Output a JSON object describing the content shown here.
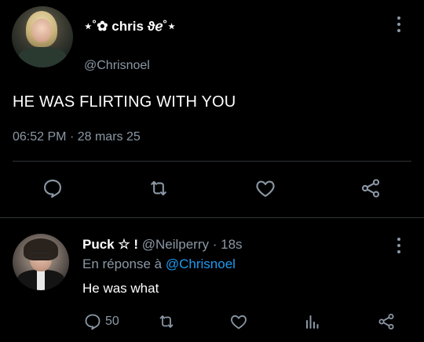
{
  "main_tweet": {
    "display_name": "⋆˚✿ chris ϑℯ˚⋆",
    "handle": "@Chrisnoel",
    "text": "HE WAS FLIRTING WITH YOU",
    "time": "06:52 PM",
    "separator": "·",
    "date": "28 mars 25",
    "icons": [
      "reply-icon",
      "retweet-icon",
      "like-icon",
      "share-icon",
      "more-icon"
    ]
  },
  "reply_tweet": {
    "display_name": "Puck ☆ !",
    "handle": "@Neilperry",
    "separator": "·",
    "age": "18s",
    "replying_to_prefix": "En réponse à",
    "replying_to_handle": "@Chrisnoel",
    "text": "He was what",
    "reply_count": "50",
    "icons": [
      "reply-icon",
      "retweet-icon",
      "like-icon",
      "analytics-icon",
      "share-icon",
      "more-icon"
    ]
  },
  "colors": {
    "background": "#000000",
    "primary_text": "#ffffff",
    "secondary_text": "#8b98a5",
    "link": "#1d9bf0",
    "divider": "#2f3336",
    "icon": "#8b98a5"
  }
}
